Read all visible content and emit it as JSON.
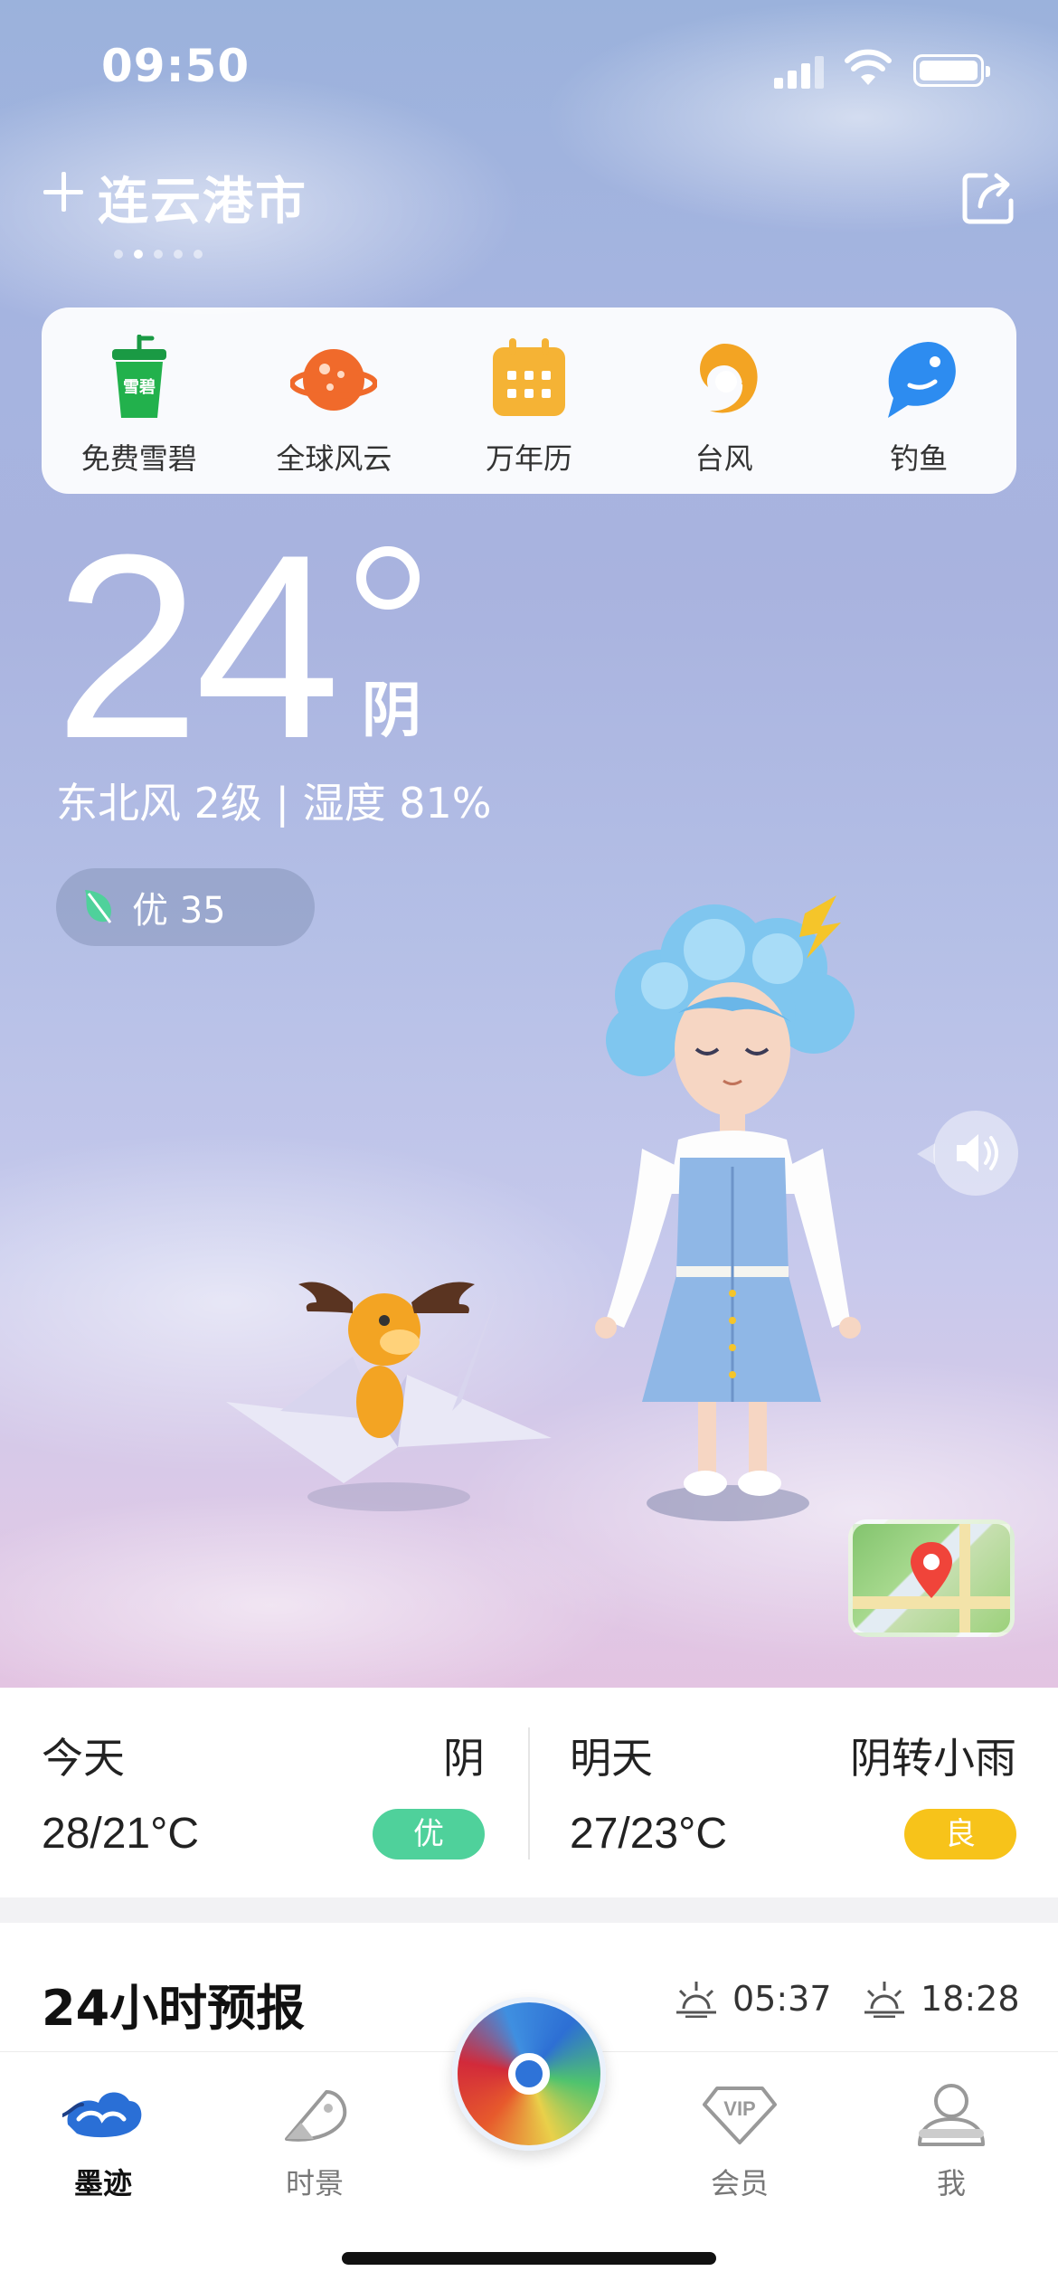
{
  "status_bar": {
    "time": "09:50"
  },
  "header": {
    "city": "连云港市",
    "page_count": 5,
    "active_page": 1
  },
  "shortcuts": [
    {
      "label": "免费雪碧",
      "icon": "sprite-cup-icon",
      "cup_text": "雪碧"
    },
    {
      "label": "全球风云",
      "icon": "planet-icon"
    },
    {
      "label": "万年历",
      "icon": "calendar-icon"
    },
    {
      "label": "台风",
      "icon": "typhoon-icon"
    },
    {
      "label": "钓鱼",
      "icon": "fish-icon"
    }
  ],
  "current": {
    "temperature": "24",
    "condition": "阴",
    "wind_humidity": "东北风 2级 | 湿度 81%",
    "aqi": "优 35"
  },
  "forecast": {
    "today": {
      "day": "今天",
      "condition": "阴",
      "temp": "28/21°C",
      "aqi": "优",
      "aqi_color": "#4fd19b"
    },
    "tomorrow": {
      "day": "明天",
      "condition": "阴转小雨",
      "temp": "27/23°C",
      "aqi": "良",
      "aqi_color": "#f7c31a"
    }
  },
  "hourly": {
    "title": "24小时预报",
    "sunrise": "05:37",
    "sunset": "18:28"
  },
  "tabbar": {
    "tabs": [
      {
        "label": "墨迹",
        "icon": "moji-logo-icon",
        "active": true
      },
      {
        "label": "时景",
        "icon": "scene-icon",
        "active": false
      },
      {
        "label": "会员",
        "icon": "vip-icon",
        "active": false
      },
      {
        "label": "我",
        "icon": "profile-icon",
        "active": false
      }
    ]
  }
}
